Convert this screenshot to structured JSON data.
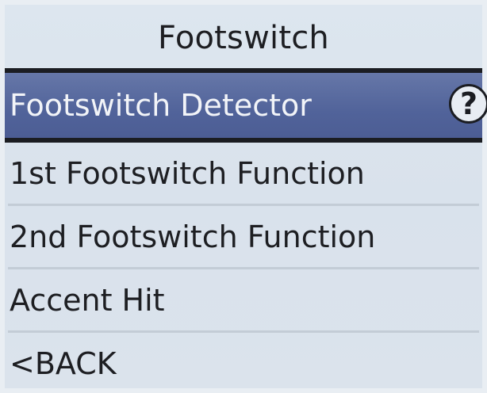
{
  "header": {
    "title": "Footswitch"
  },
  "menu": {
    "items": [
      {
        "label": "Footswitch Detector",
        "selected": true,
        "help_glyph": "?"
      },
      {
        "label": "1st Footswitch Function"
      },
      {
        "label": "2nd Footswitch Function"
      },
      {
        "label": "Accent Hit"
      },
      {
        "label": "<BACK"
      }
    ]
  },
  "colors": {
    "selected_bg": "#51639a",
    "selected_text": "#f2f4f8",
    "background": "#dde6ef",
    "text": "#1d1e22"
  },
  "icons": {
    "help": "help-icon"
  }
}
